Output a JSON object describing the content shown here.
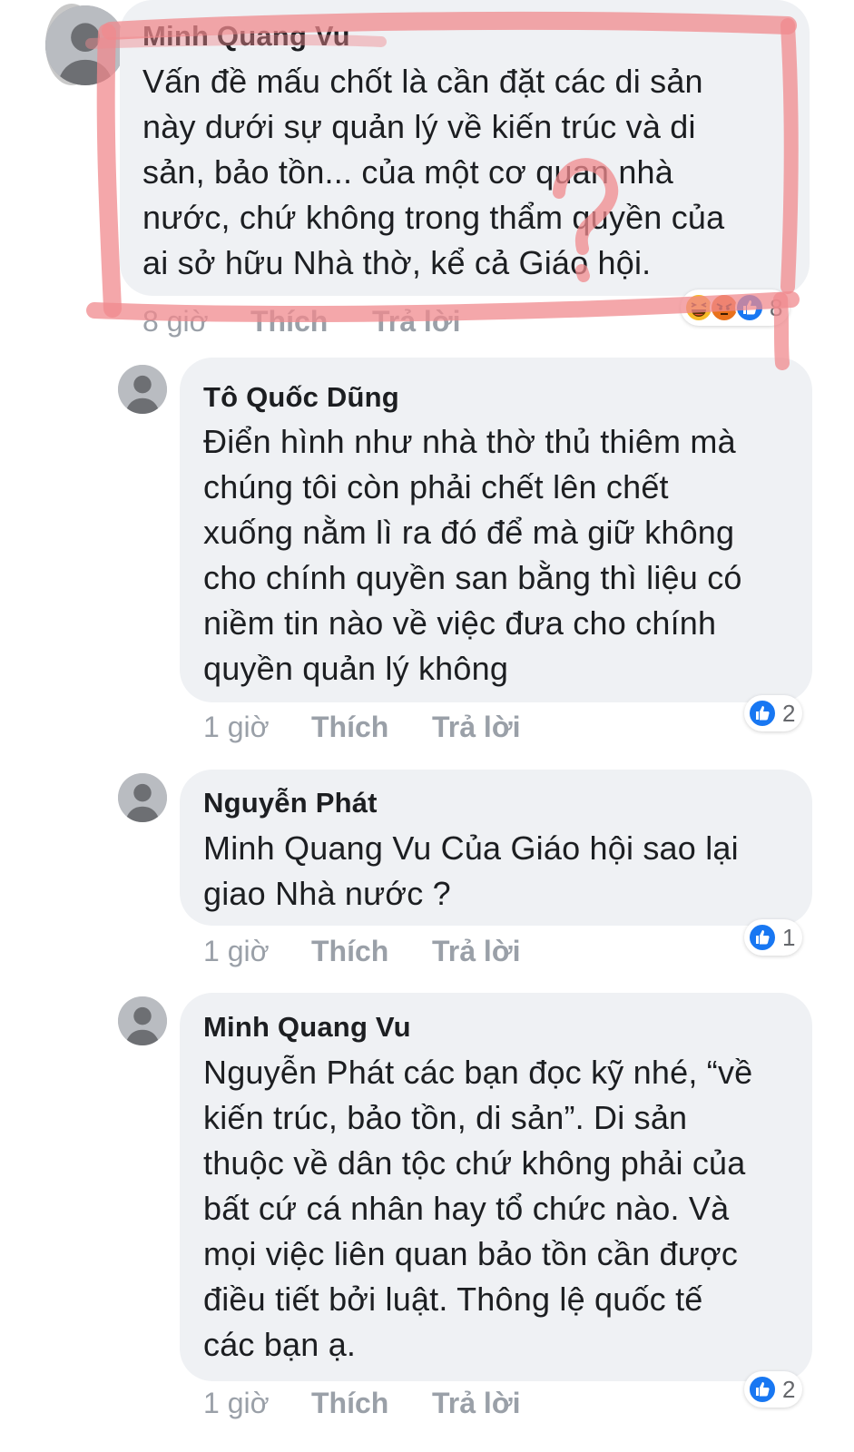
{
  "comments": [
    {
      "author": "Minh Quang Vu",
      "text": "Vấn đề mấu chốt là cần đặt các di sản\nnày dưới sự quản lý về kiến trúc và di\nsản, bảo tồn... của một cơ quan nhà\nnước, chứ không trong thẩm quyền của\nai sở hữu Nhà thờ, kể cả Giáo hội.",
      "time": "8 giờ",
      "like_label": "Thích",
      "reply_label": "Trả lời",
      "reaction_icons": [
        "haha-icon",
        "angry-icon",
        "like-icon"
      ],
      "reaction_count": "8"
    },
    {
      "author": "Tô Quốc Dũng",
      "text": "Điển hình như nhà thờ thủ thiêm mà\nchúng tôi còn phải chết lên chết\nxuống nằm lì ra đó để mà giữ không\ncho chính quyền san bằng thì liệu có\nniềm tin nào về việc đưa cho chính\nquyền quản lý không",
      "time": "1 giờ",
      "like_label": "Thích",
      "reply_label": "Trả lời",
      "reaction_icons": [
        "like-icon"
      ],
      "reaction_count": "2"
    },
    {
      "author": "Nguyễn Phát",
      "text": "Minh Quang Vu Của Giáo hội sao lại\ngiao Nhà nước ?",
      "time": "1 giờ",
      "like_label": "Thích",
      "reply_label": "Trả lời",
      "reaction_icons": [
        "like-icon"
      ],
      "reaction_count": "1"
    },
    {
      "author": "Minh Quang Vu",
      "text": "Nguyễn Phát các bạn đọc kỹ nhé, “về\nkiến trúc, bảo tồn, di sản”. Di sản\nthuộc về dân tộc chứ không phải của\nbất cứ cá nhân hay tổ chức nào. Và\nmọi việc liên quan bảo tồn cần được\nđiều tiết bởi luật. Thông lệ quốc tế\ncác bạn ạ.",
      "time": "1 giờ",
      "like_label": "Thích",
      "reply_label": "Trả lời",
      "reaction_icons": [
        "like-icon"
      ],
      "reaction_count": "2"
    }
  ],
  "colors": {
    "bubble": "#eff1f4",
    "meta": "#9aa0a8",
    "annotation": "#f08a8e",
    "like_blue": "#1877f2"
  }
}
